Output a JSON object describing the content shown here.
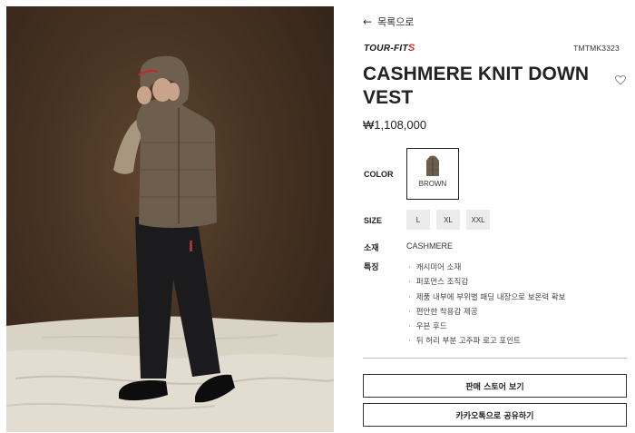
{
  "nav": {
    "back_label": "목록으로"
  },
  "product": {
    "brand": "TOUR-FIT",
    "brand_mark": "S",
    "sku": "TMTMK3323",
    "name": "CASHMERE KNIT DOWN VEST",
    "price": "₩1,108,000",
    "color_label": "COLOR",
    "color_option": "BROWN",
    "size_label": "SIZE",
    "sizes": [
      "L",
      "XL",
      "XXL"
    ],
    "material_label": "소재",
    "material_value": "CASHMERE",
    "features_label": "특징",
    "features": [
      "캐시미어 소재",
      "퍼포먼스 조직감",
      "제품 내부에 부위별 패딩 내장으로 보온력 확보",
      "편안한 착용감 제공",
      "우븐 후드",
      "뒤 허리 부분 고주파 로고 포인트"
    ]
  },
  "actions": {
    "store_button": "판매 스토어 보기",
    "share_button": "카카오톡으로 공유하기"
  },
  "icons": {
    "back": "arrow-left-icon",
    "wishlist": "heart-icon"
  },
  "colors": {
    "accent": "#d8262a",
    "text": "#222222",
    "size_bg": "#ececec"
  }
}
